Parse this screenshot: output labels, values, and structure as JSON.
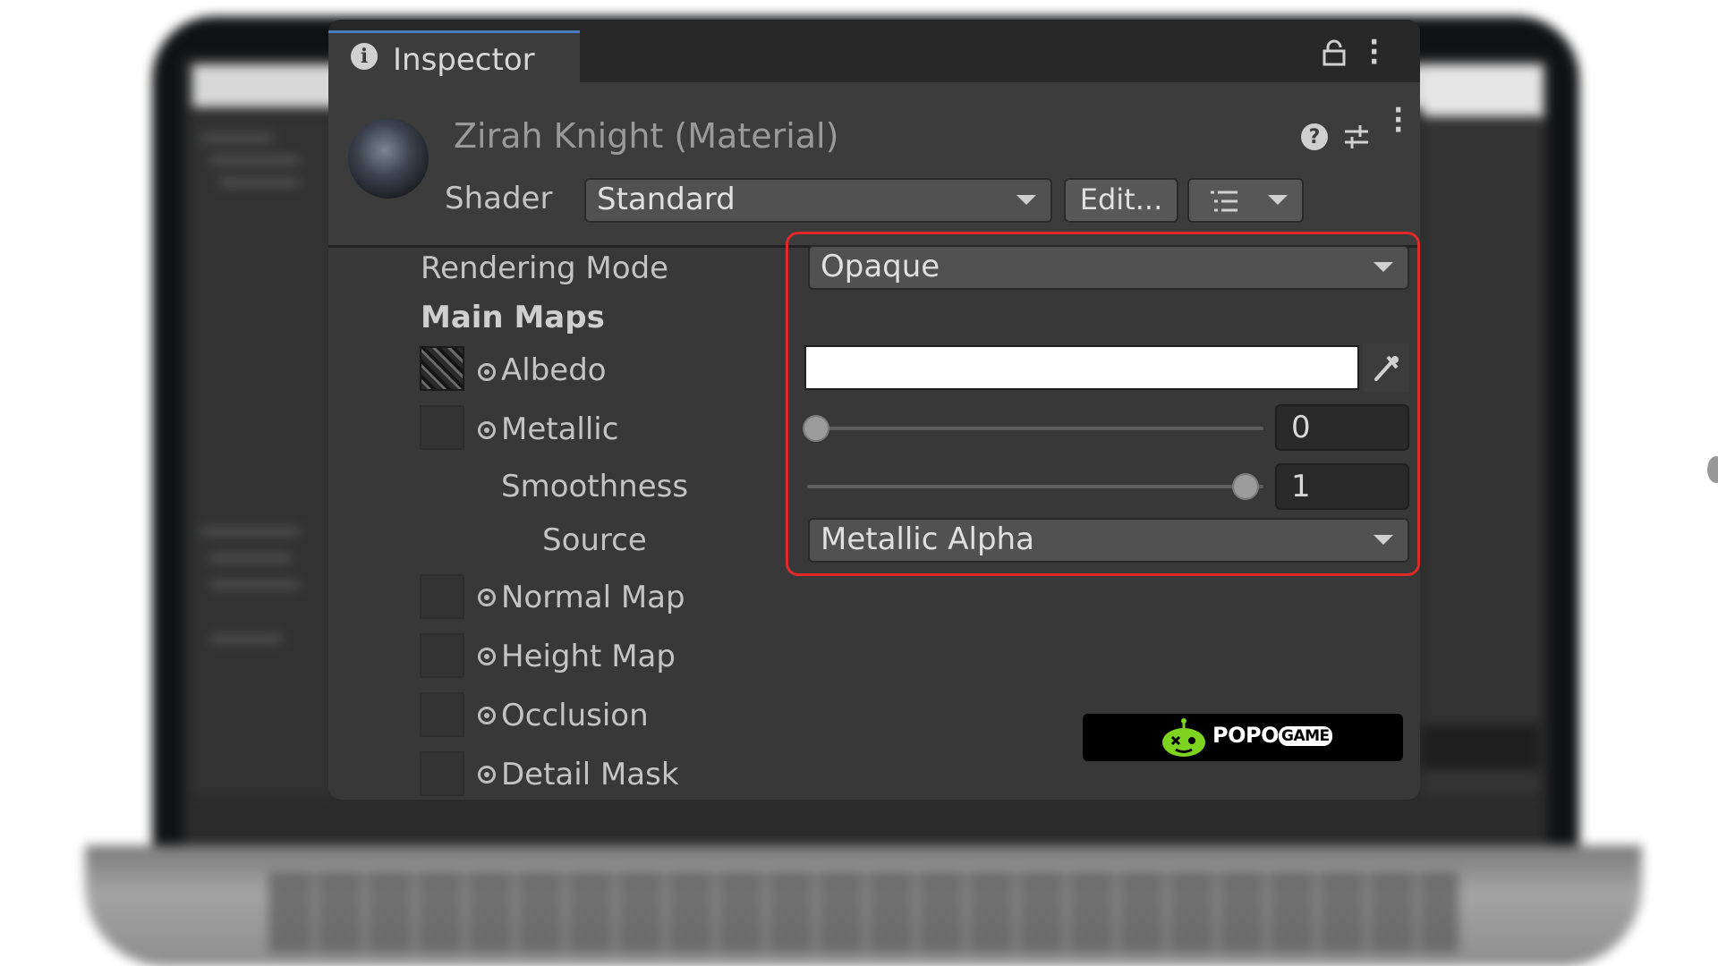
{
  "inspector": {
    "tab_title": "Inspector",
    "material_title": "Zirah Knight (Material)",
    "shader": {
      "label": "Shader",
      "value": "Standard",
      "edit_button": "Edit..."
    },
    "rendering_mode": {
      "label": "Rendering Mode",
      "value": "Opaque"
    },
    "main_maps": {
      "heading": "Main Maps",
      "albedo": {
        "label": "Albedo",
        "color": "#ffffff"
      },
      "metallic": {
        "label": "Metallic",
        "value": "0",
        "slider_fraction": 0
      },
      "smoothness": {
        "label": "Smoothness",
        "value": "1",
        "slider_fraction": 1
      },
      "source": {
        "label": "Source",
        "value": "Metallic Alpha"
      },
      "normal_map": {
        "label": "Normal Map"
      },
      "height_map": {
        "label": "Height Map"
      },
      "occlusion": {
        "label": "Occlusion"
      },
      "detail_mask": {
        "label": "Detail Mask"
      }
    },
    "highlight_color": "#e02a2a"
  },
  "watermark": {
    "brand": "POPO",
    "brand_suffix": "GAME",
    "icon": "robot-face-icon",
    "color": "#7ed321"
  }
}
